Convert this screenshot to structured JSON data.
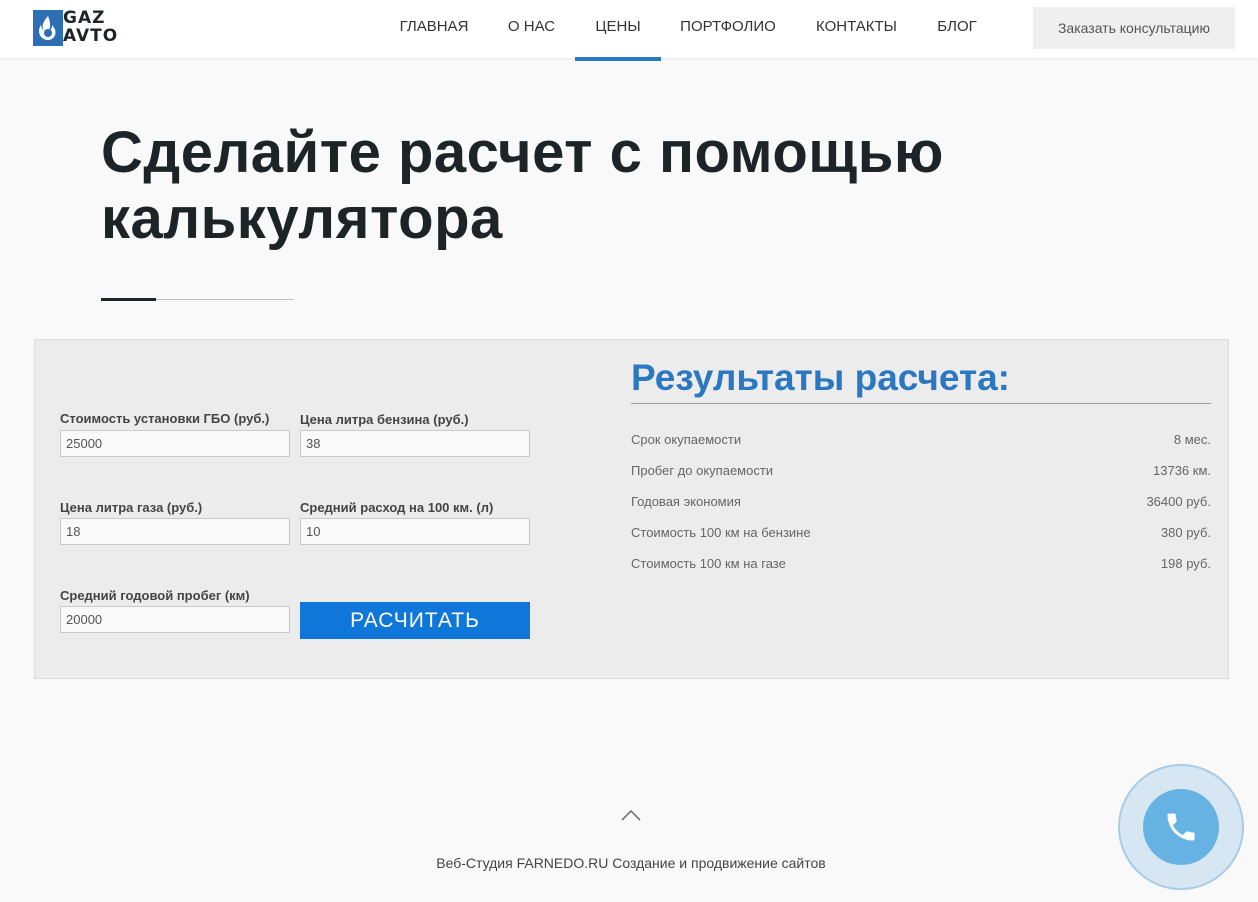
{
  "header": {
    "logo": {
      "line1": "GAZ",
      "line2": "AVTO"
    },
    "nav": [
      {
        "label": "ГЛАВНАЯ",
        "active": false
      },
      {
        "label": "О НАС",
        "active": false
      },
      {
        "label": "ЦЕНЫ",
        "active": true
      },
      {
        "label": "ПОРТФОЛИО",
        "active": false
      },
      {
        "label": "КОНТАКТЫ",
        "active": false
      },
      {
        "label": "БЛОГ",
        "active": false
      }
    ],
    "cta_label": "Заказать консультацию"
  },
  "page": {
    "title": "Сделайте расчет с помощью калькулятора"
  },
  "calculator": {
    "fields": {
      "install_cost": {
        "label": "Стоимость установки ГБО (руб.)",
        "value": "25000"
      },
      "petrol_price": {
        "label": "Цена литра бензина (руб.)",
        "value": "38"
      },
      "gas_price": {
        "label": "Цена литра газа (руб.)",
        "value": "18"
      },
      "consumption": {
        "label": "Средний расход на 100 км. (л)",
        "value": "10"
      },
      "annual_mileage": {
        "label": "Средний годовой пробег (км)",
        "value": "20000"
      }
    },
    "button_label": "РАСЧИТАТЬ"
  },
  "results": {
    "title": "Результаты расчета:",
    "rows": [
      {
        "label": "Срок окупаемости",
        "value": "8 мес."
      },
      {
        "label": "Пробег до окупаемости",
        "value": "13736 км."
      },
      {
        "label": "Годовая экономия",
        "value": "36400 руб."
      },
      {
        "label": "Стоимость 100 км на бензине",
        "value": "380 руб."
      },
      {
        "label": "Стоимость 100 км на газе",
        "value": "198 руб."
      }
    ]
  },
  "footer": {
    "text": "Веб-Студия FARNEDO.RU Создание и продвижение сайтов"
  },
  "colors": {
    "accent": "#2b78c2",
    "button": "#0e77d9",
    "call_button": "#66b2e3"
  },
  "icons": {
    "scroll_up": "chevron-up-icon",
    "call": "phone-icon",
    "logo_mark": "flame-icon"
  }
}
